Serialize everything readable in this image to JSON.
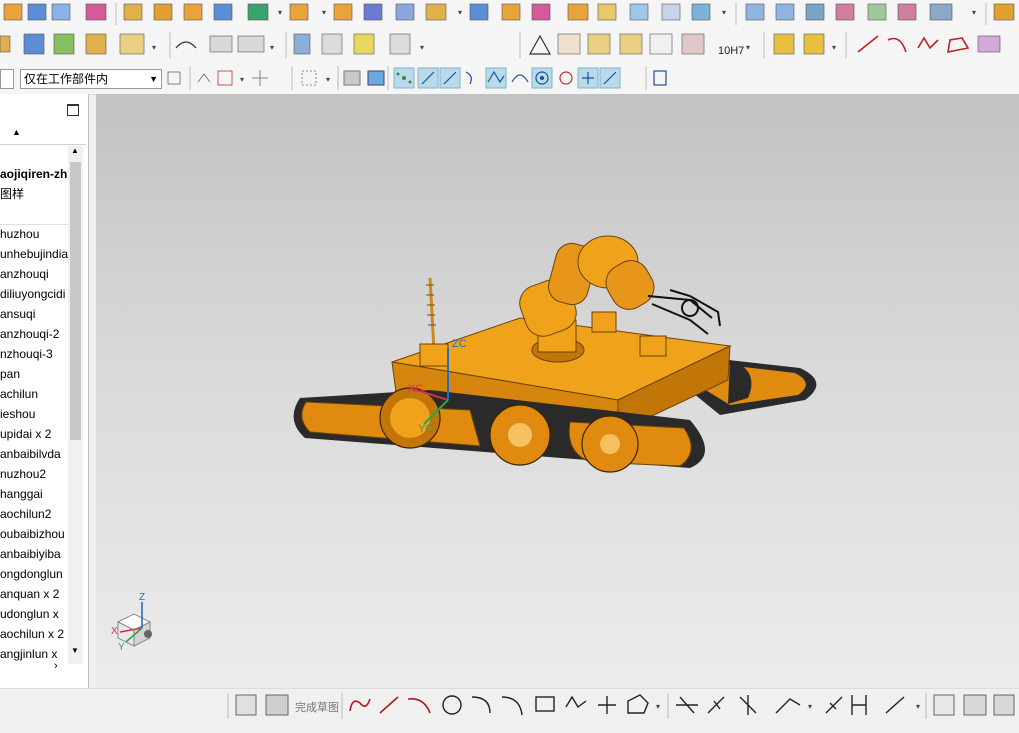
{
  "toolbar": {
    "selection_scope": "仅在工作部件内",
    "filter_label": "",
    "hole_label": "10H7"
  },
  "nav": {
    "items": [
      "aojiqiren-zh",
      "图样",
      "",
      "huzhou",
      "unhebujindia",
      "anzhouqi",
      "diliuyongcidi",
      "ansuqi",
      "anzhouqi-2",
      "nzhouqi-3",
      "pan",
      "achilun",
      "ieshou",
      "upidai x 2",
      "anbaibilvda",
      "nuzhou2",
      "hanggai",
      "aochilun2",
      "oubaibizhou",
      "anbaibiyiba",
      "ongdonglun",
      "anquan x 2",
      "udonglun x",
      "aochilun x 2",
      "angjinlun x"
    ]
  },
  "viewport": {
    "csys_labels": {
      "zc": "ZC",
      "xc": "XC",
      "yc": "YC"
    },
    "triad_labels": {
      "z": "Z",
      "x": "X",
      "y": "Y"
    }
  },
  "bottom": {
    "finish_sketch_label": "完成草图"
  },
  "colors": {
    "model": "#f0a21a",
    "model_shade": "#c97a0a",
    "track": "#2a2a2a",
    "accent": "#1f6fc5"
  }
}
